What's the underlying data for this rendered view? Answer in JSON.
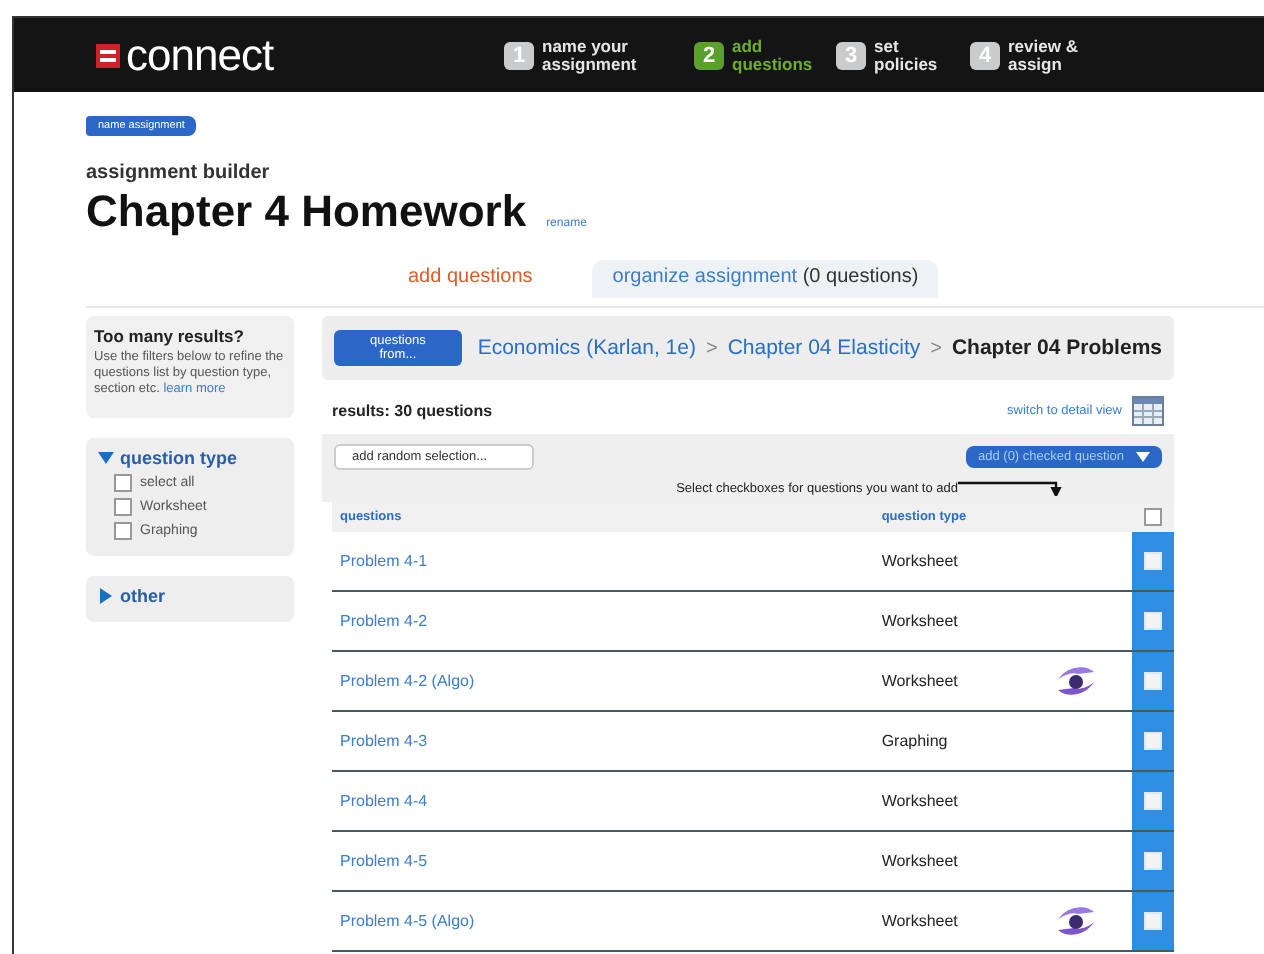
{
  "brand": {
    "name": "connect"
  },
  "steps": [
    {
      "number": "1",
      "label": "name your assignment",
      "selected": false
    },
    {
      "number": "2",
      "label": "add questions",
      "selected": true
    },
    {
      "number": "3",
      "label": "set policies",
      "selected": false
    },
    {
      "number": "4",
      "label": "review & assign",
      "selected": false
    }
  ],
  "back_button": "name assignment",
  "subtitle": "assignment builder",
  "title": "Chapter 4 Homework",
  "rename_link": "rename",
  "tabs": [
    {
      "label": "add questions",
      "selected": true
    },
    {
      "label": "organize assignment",
      "count": "(0 questions)",
      "selected": false
    }
  ],
  "sidebar": {
    "hint_title": "Too many results?",
    "hint_text": "Use the filters below to refine the questions list by question type, section etc.",
    "hint_link": "learn more",
    "filters": [
      {
        "label": "question type",
        "expanded": true,
        "options": [
          {
            "label": "select all",
            "checked": false
          },
          {
            "label": "Worksheet",
            "checked": false
          },
          {
            "label": "Graphing",
            "checked": false
          }
        ]
      },
      {
        "label": "other",
        "expanded": false
      }
    ]
  },
  "breadcrumb": {
    "button": "questions from...",
    "parts": [
      "Economics (Karlan, 1e)",
      "Chapter 04 Elasticity",
      "Chapter 04 Problems"
    ],
    "separator": ">"
  },
  "results": "results: 30 questions",
  "detail_view_link": "switch to detail view",
  "random_button": "add random selection...",
  "add_checked_button": "add (0) checked question",
  "instruction": "Select checkboxes for questions you want to add",
  "table": {
    "columns": [
      "questions",
      "question type"
    ],
    "header_checked": false,
    "rows": [
      {
        "name": "Problem 4-1",
        "type": "Worksheet",
        "algo": false,
        "checked": false
      },
      {
        "name": "Problem 4-2",
        "type": "Worksheet",
        "algo": false,
        "checked": false
      },
      {
        "name": "Problem 4-2 (Algo)",
        "type": "Worksheet",
        "algo": true,
        "checked": false
      },
      {
        "name": "Problem 4-3",
        "type": "Graphing",
        "algo": false,
        "checked": false
      },
      {
        "name": "Problem 4-4",
        "type": "Worksheet",
        "algo": false,
        "checked": false
      },
      {
        "name": "Problem 4-5",
        "type": "Worksheet",
        "algo": false,
        "checked": false
      },
      {
        "name": "Problem 4-5 (Algo)",
        "type": "Worksheet",
        "algo": true,
        "checked": false
      }
    ]
  }
}
